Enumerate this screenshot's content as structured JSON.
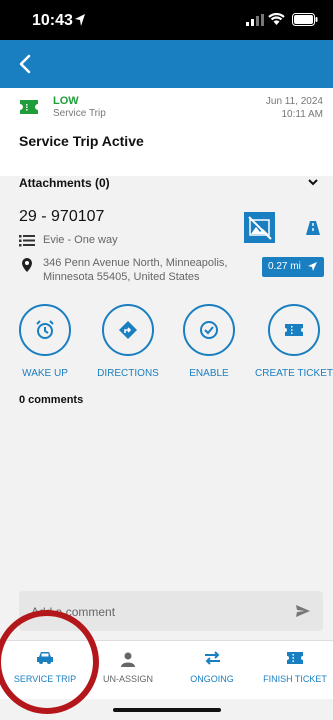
{
  "status_bar": {
    "time": "10:43"
  },
  "trip": {
    "priority": "LOW",
    "type": "Service Trip",
    "date": "Jun 11, 2024",
    "time": "10:11 AM",
    "title": "Service Trip Active",
    "attachments_label": "Attachments (0)",
    "ticket_number": "29 - 970107",
    "driver": "Evie - One way",
    "address": "346 Penn Avenue North, Minneapolis, Minnesota 55405, United States",
    "distance": "0.27 mi"
  },
  "actions": [
    {
      "label": "WAKE UP",
      "icon": "alarm-clock-icon"
    },
    {
      "label": "DIRECTIONS",
      "icon": "directions-icon"
    },
    {
      "label": "ENABLE",
      "icon": "check-circle-icon"
    },
    {
      "label": "CREATE TICKET",
      "icon": "ticket-icon"
    }
  ],
  "comments": {
    "count_label": "0 comments",
    "placeholder": "Add a comment"
  },
  "bottom_nav": [
    {
      "label": "SERVICE TRIP",
      "icon": "car-icon"
    },
    {
      "label": "UN-ASSIGN",
      "icon": "person-icon"
    },
    {
      "label": "ONGOING",
      "icon": "swap-arrows-icon"
    },
    {
      "label": "FINISH TICKET",
      "icon": "ticket-icon"
    }
  ],
  "colors": {
    "brand_blue": "#1a7fc1",
    "priority_green": "#1f9d3a",
    "annotation_red": "#b3171b"
  }
}
